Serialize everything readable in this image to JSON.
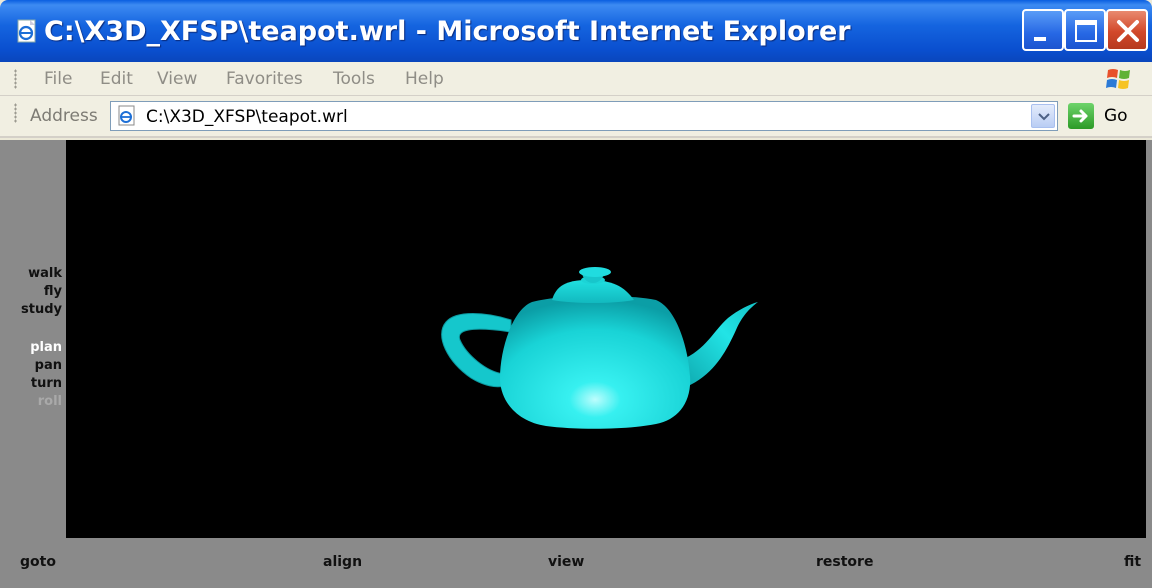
{
  "window": {
    "title": "C:\\X3D_XFSP\\teapot.wrl - Microsoft Internet Explorer",
    "icon": "ie-page-icon",
    "controls": [
      "minimize-icon",
      "maximize-icon",
      "close-icon"
    ]
  },
  "menubar": {
    "items": [
      "File",
      "Edit",
      "View",
      "Favorites",
      "Tools",
      "Help"
    ]
  },
  "address": {
    "label": "Address",
    "value": "C:\\X3D_XFSP\\teapot.wrl",
    "go_label": "Go"
  },
  "viewer": {
    "nav_modes": [
      "walk",
      "fly",
      "study"
    ],
    "nav_tools": [
      "plan",
      "pan",
      "turn",
      "roll"
    ],
    "active_tool": "plan",
    "disabled_tool": "roll",
    "bottom_controls": [
      "goto",
      "align",
      "view",
      "restore",
      "fit"
    ],
    "scene_object": "teapot",
    "colors": {
      "background": "#000000",
      "teapot": "#1ee6e6",
      "panel": "#8a8a8a"
    }
  }
}
